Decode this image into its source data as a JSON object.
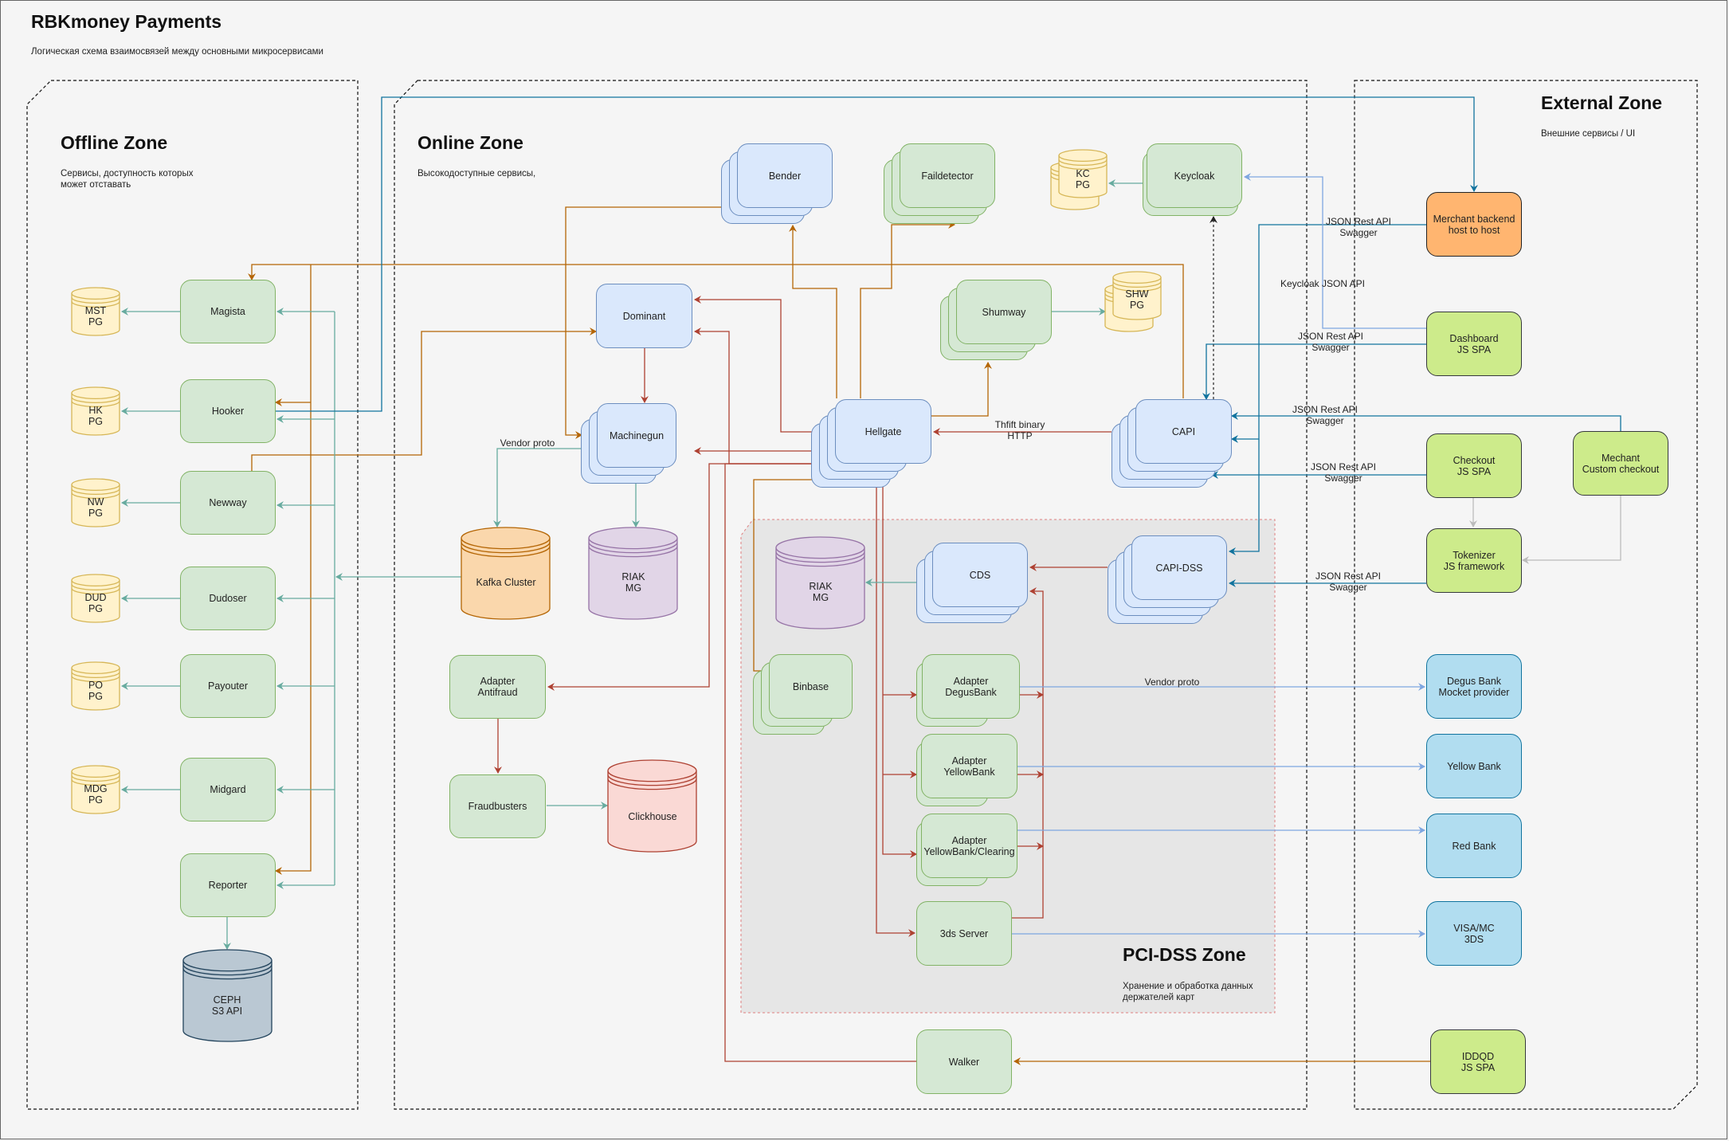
{
  "header": {
    "title": "RBKmoney Payments",
    "subtitle": "Логическая схема взаимосвязей между основными микросервисами"
  },
  "zones": {
    "offline": {
      "title": "Offline Zone",
      "desc": "Сервисы, доступность которых\nможет отставать"
    },
    "online": {
      "title": "Online Zone",
      "desc": "Высокодоступные сервисы,"
    },
    "external": {
      "title": "External Zone",
      "desc": "Внешние сервисы / UI"
    },
    "pci": {
      "title": "PCI-DSS Zone",
      "desc": "Хранение и обработка данных\nдержателей карт"
    }
  },
  "services": {
    "magista": "Magista",
    "hooker": "Hooker",
    "newway": "Newway",
    "dudoser": "Dudoser",
    "payouter": "Payouter",
    "midgard": "Midgard",
    "reporter": "Reporter",
    "bender": "Bender",
    "faildetector": "Faildetector",
    "keycloak": "Keycloak",
    "dominant": "Dominant",
    "machinegun": "Machinegun",
    "shumway": "Shumway",
    "hellgate": "Hellgate",
    "capi": "CAPI",
    "adapter_antifraud": "Adapter\nAntifraud",
    "fraudbusters": "Fraudbusters",
    "cds": "CDS",
    "capi_dss": "CAPI-DSS",
    "binbase": "Binbase",
    "adapter_degus": "Adapter\nDegusBank",
    "adapter_yellow": "Adapter\nYellowBank",
    "adapter_yellow_clearing": "Adapter\nYellowBank/Clearing",
    "server_3ds": "3ds Server",
    "walker": "Walker"
  },
  "databases": {
    "mst_pg": "MST\nPG",
    "hk_pg": "HK\nPG",
    "nw_pg": "NW\nPG",
    "dud_pg": "DUD\nPG",
    "po_pg": "PO\nPG",
    "mdg_pg": "MDG\nPG",
    "ceph": "CEPH\nS3 API",
    "kc_pg": "KC\nPG",
    "shw_pg": "SHW\nPG",
    "kafka": "Kafka Cluster",
    "riak_mg": "RIAK\nMG",
    "riak_mg_pci": "RIAK\nMG",
    "clickhouse": "Clickhouse"
  },
  "external": {
    "merchant_backend": "Merchant backend\nhost to host",
    "dashboard": "Dashboard\nJS SPA",
    "checkout": "Checkout\nJS SPA",
    "merchant_custom": "Mechant\nCustom checkout",
    "tokenizer": "Tokenizer\nJS framework",
    "degus_bank": "Degus Bank\nMocket provider",
    "yellow_bank": "Yellow Bank",
    "red_bank": "Red Bank",
    "visa_mc": "VISA/MC\n3DS",
    "iddqd": "IDDQD\nJS SPA"
  },
  "edge_labels": {
    "json_rest_1": "JSON Rest API\nSwagger",
    "keycloak_json": "Keycloak JSON API",
    "json_rest_2": "JSON Rest API\nSwagger",
    "json_rest_3": "JSON Rest API\nSwagger",
    "json_rest_4": "JSON Rest API\nSwagger",
    "json_rest_5": "JSON Rest API\nSwagger",
    "thrift": "Thfift binary\nHTTP",
    "vendor_proto_mg": "Vendor proto",
    "vendor_proto_bank": "Vendor proto"
  },
  "colors": {
    "orange_edge": "#b46504",
    "red_edge": "#ae4132",
    "teal_edge": "#67ab9f",
    "blue_edge": "#10739e",
    "light_blue_edge": "#7ea6e0",
    "gray_edge": "#bbbbbb"
  }
}
